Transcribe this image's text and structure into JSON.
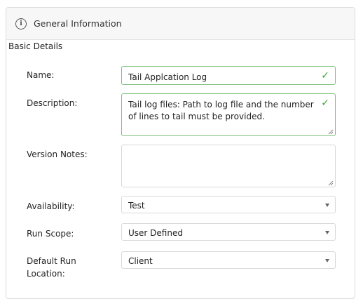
{
  "panel": {
    "title": "General Information"
  },
  "section": {
    "title": "Basic Details"
  },
  "fields": {
    "name": {
      "label": "Name:",
      "value": "Tail Applcation Log"
    },
    "description": {
      "label": "Description:",
      "value": "Tail log files: Path to log file and the number of lines to tail must be provided."
    },
    "version_notes": {
      "label": "Version Notes:",
      "value": ""
    },
    "availability": {
      "label": "Availability:",
      "value": "Test"
    },
    "run_scope": {
      "label": "Run Scope:",
      "value": "User Defined"
    },
    "default_run_location": {
      "label": "Default Run Location:",
      "value": "Client"
    }
  },
  "icons": {
    "header": "info-circle-icon",
    "valid": "checkmark-icon",
    "dropdown": "caret-down-icon",
    "resize": "resize-handle-icon"
  },
  "colors": {
    "valid_border": "#7cc27c",
    "valid_check": "#3aa63a",
    "header_bg": "#f7f7f7"
  }
}
